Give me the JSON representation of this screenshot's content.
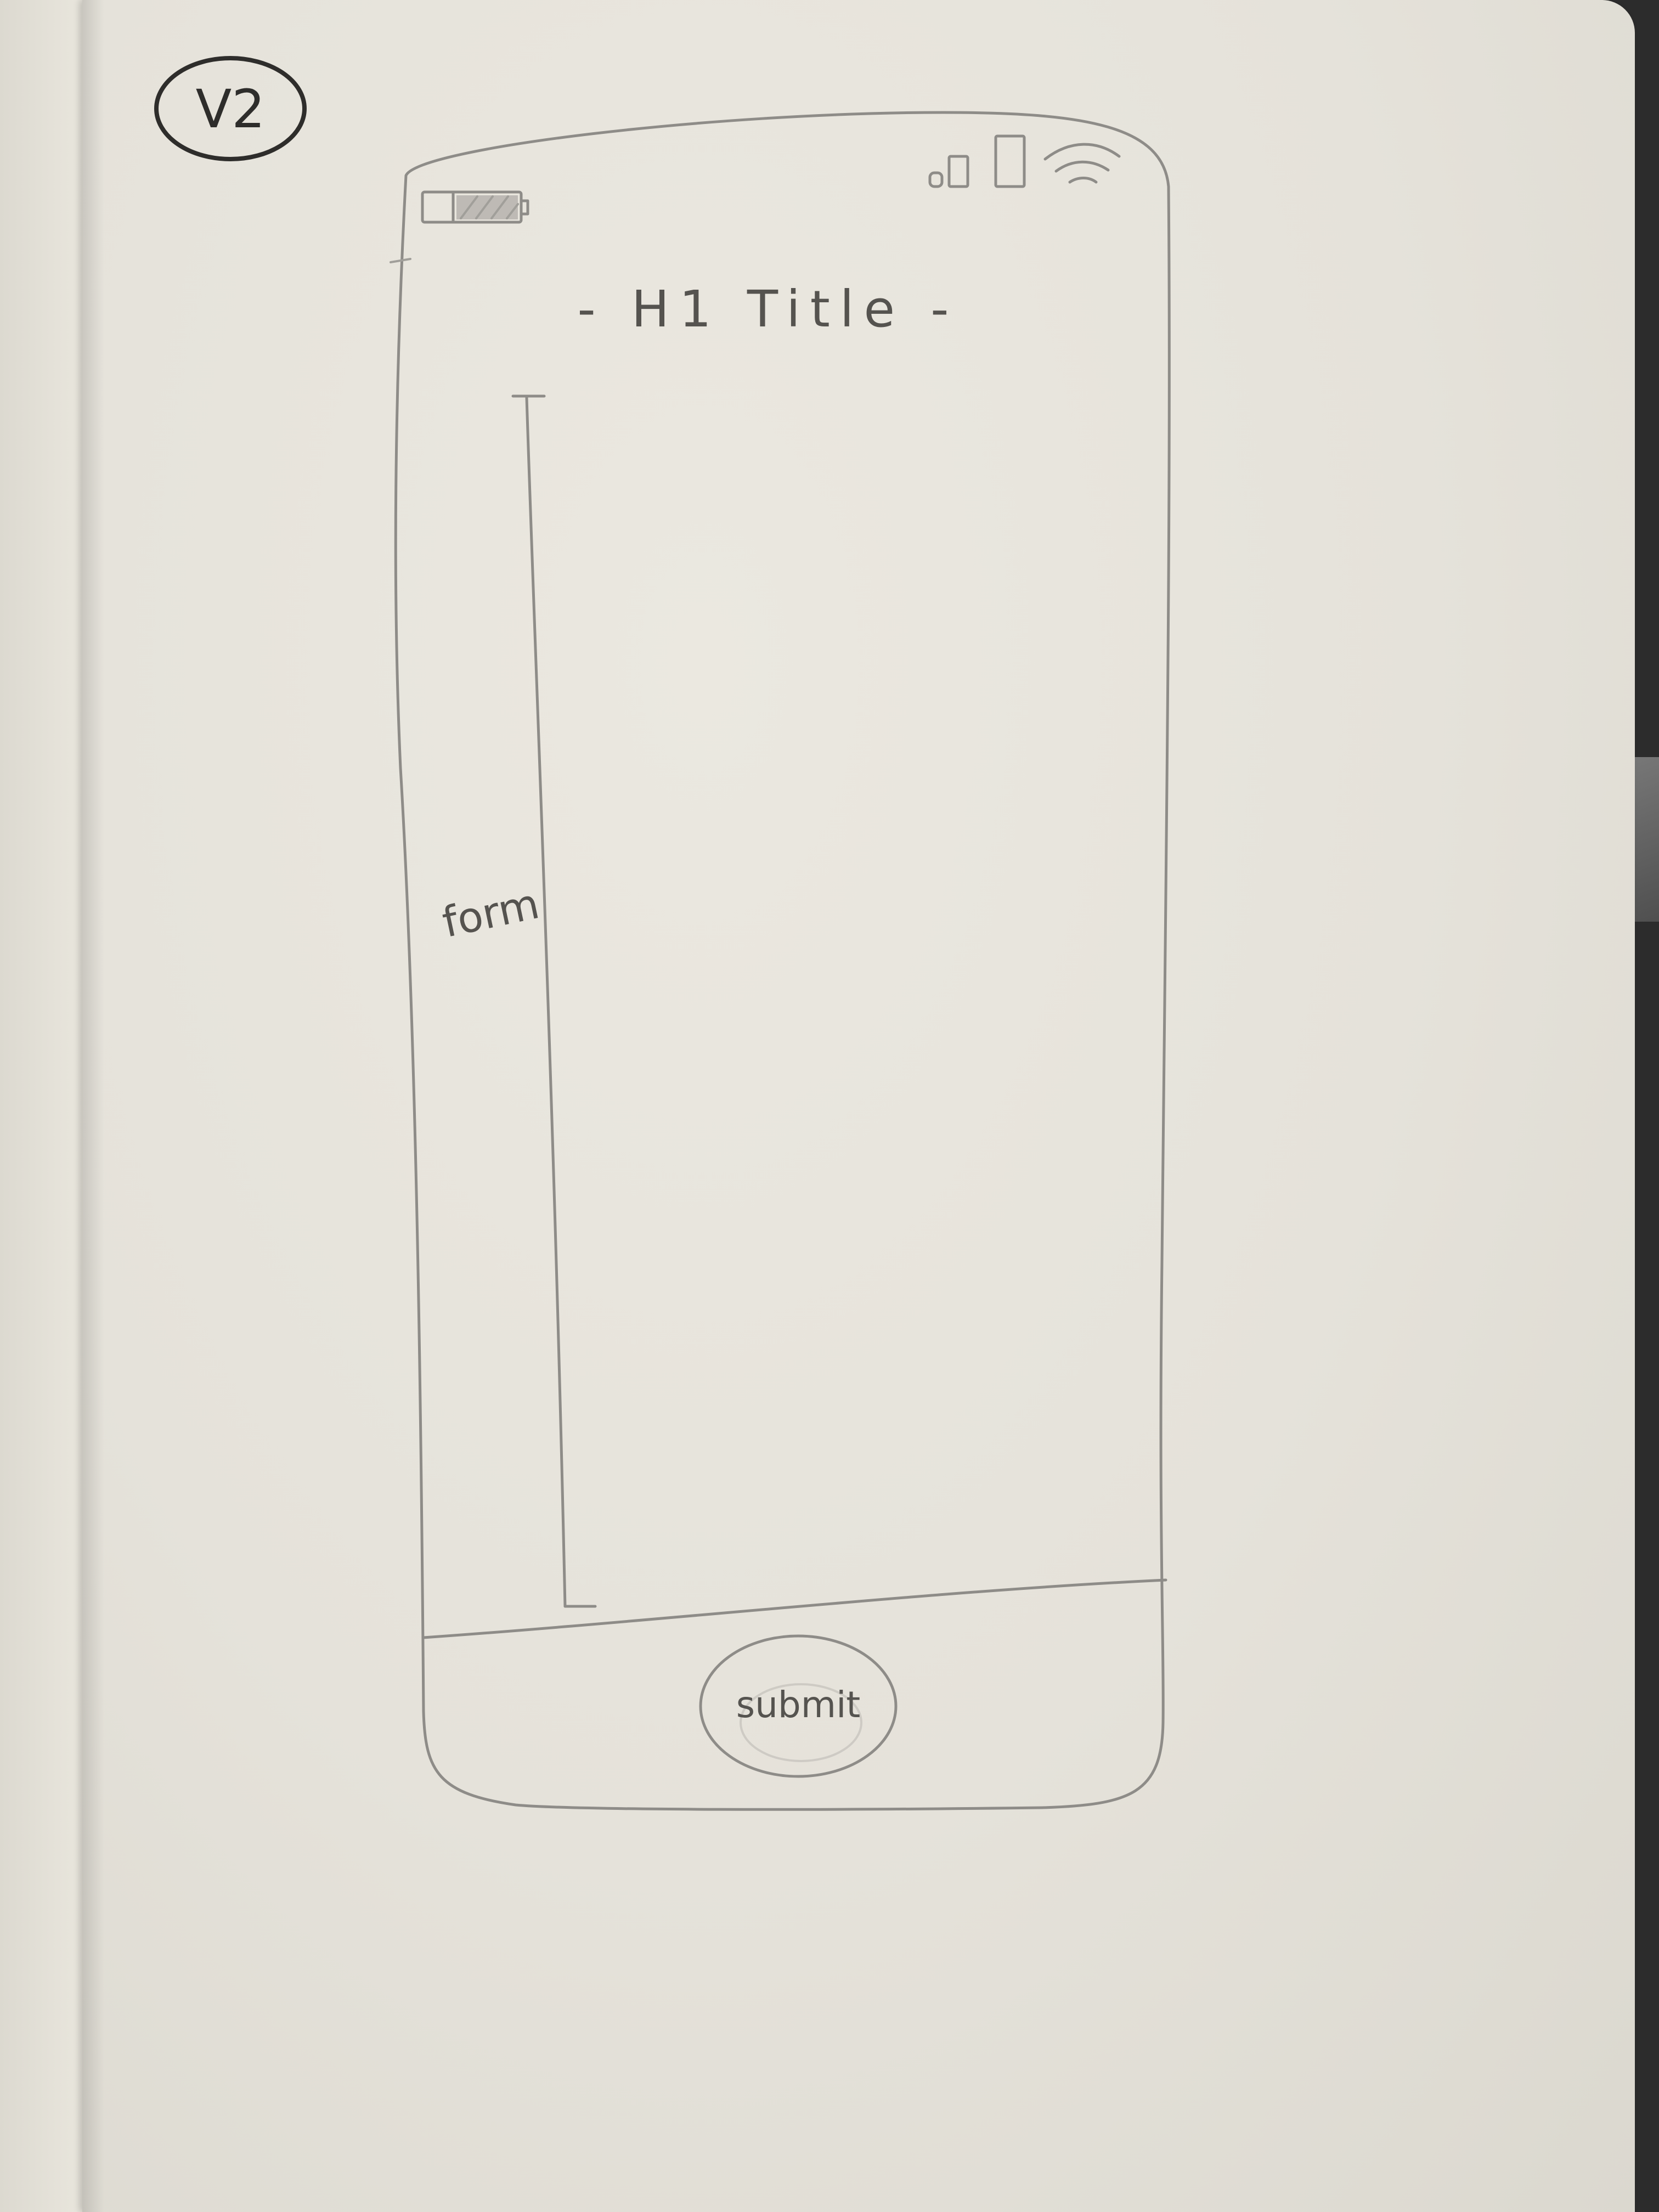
{
  "sketch": {
    "version_label": "V2",
    "title_text": "- H1   Title -",
    "form_label": "form",
    "submit_label": "submit"
  },
  "colors": {
    "paper": "#e8e5dd",
    "pencil": "#8e8c88",
    "ink": "#2e2d2b",
    "background": "#2c2c2c"
  },
  "status_bar": {
    "left_icon": "battery-icon",
    "right_icons": [
      "signal-bars-icon",
      "wifi-icon"
    ]
  }
}
